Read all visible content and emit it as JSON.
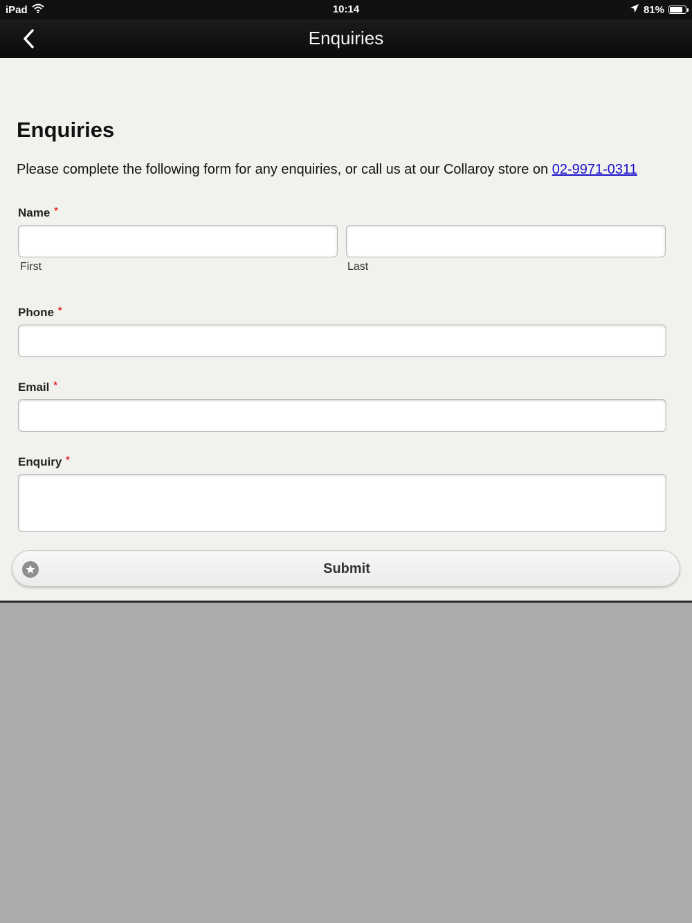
{
  "status_bar": {
    "device": "iPad",
    "time": "10:14",
    "battery": "81%",
    "battery_level": 0.81
  },
  "nav": {
    "title": "Enquiries"
  },
  "page": {
    "heading": "Enquiries",
    "intro_text": "Please complete the following form for any enquiries, or call us at our Collaroy store on ",
    "phone_link": "02-9971-0311"
  },
  "form": {
    "name_label": "Name",
    "first_label": "First",
    "last_label": "Last",
    "first_value": "",
    "last_value": "",
    "phone_label": "Phone",
    "phone_value": "",
    "email_label": "Email",
    "email_value": "",
    "enquiry_label": "Enquiry",
    "enquiry_value": "",
    "required_marker": "*",
    "submit_label": "Submit"
  },
  "colors": {
    "accent_link": "#1a0dcc",
    "required": "#e02020",
    "nav_background": "#111111",
    "content_background": "#f1f1ed"
  }
}
